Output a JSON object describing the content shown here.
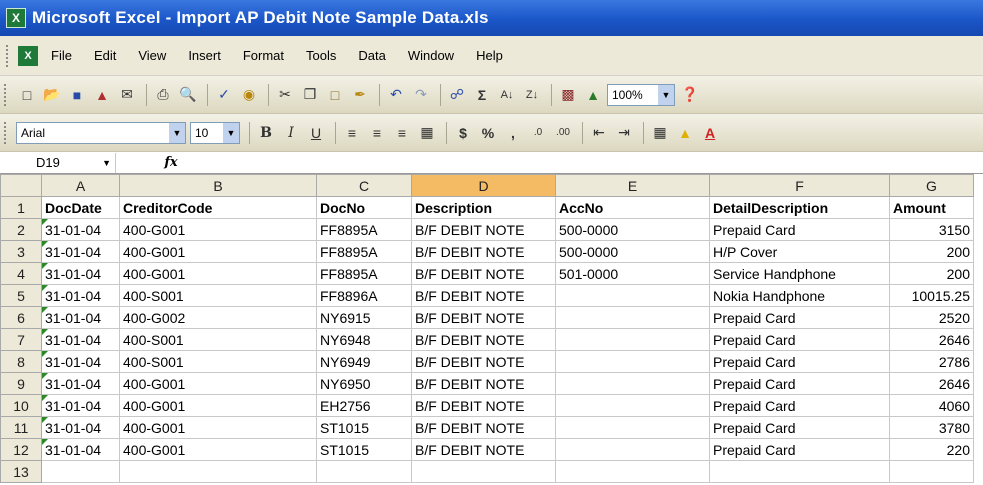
{
  "window": {
    "title": "Microsoft Excel - Import AP Debit Note Sample Data.xls",
    "app_icon": "excel-icon"
  },
  "menu": {
    "items": [
      "File",
      "Edit",
      "View",
      "Insert",
      "Format",
      "Tools",
      "Data",
      "Window",
      "Help"
    ]
  },
  "toolbar": {
    "zoom": "100%",
    "font_name": "Arial",
    "font_size": "10"
  },
  "formula_bar": {
    "cell_ref": "D19",
    "fx_label": "fx"
  },
  "sheet": {
    "columns": [
      "A",
      "B",
      "C",
      "D",
      "E",
      "F",
      "G"
    ],
    "selected_column": "D",
    "rows": [
      {
        "n": "1",
        "cells": [
          "DocDate",
          "CreditorCode",
          "DocNo",
          "Description",
          "AccNo",
          "DetailDescription",
          "Amount"
        ]
      },
      {
        "n": "2",
        "cells": [
          "31-01-04",
          "400-G001",
          "FF8895A",
          "B/F DEBIT NOTE",
          "500-0000",
          "Prepaid Card",
          "3150"
        ]
      },
      {
        "n": "3",
        "cells": [
          "31-01-04",
          "400-G001",
          "FF8895A",
          "B/F DEBIT NOTE",
          "500-0000",
          "H/P Cover",
          "200"
        ]
      },
      {
        "n": "4",
        "cells": [
          "31-01-04",
          "400-G001",
          "FF8895A",
          "B/F DEBIT NOTE",
          "501-0000",
          "Service Handphone",
          "200"
        ]
      },
      {
        "n": "5",
        "cells": [
          "31-01-04",
          "400-S001",
          "FF8896A",
          "B/F DEBIT NOTE",
          "",
          "Nokia Handphone",
          "10015.25"
        ]
      },
      {
        "n": "6",
        "cells": [
          "31-01-04",
          "400-G002",
          "NY6915",
          "B/F DEBIT NOTE",
          "",
          "Prepaid Card",
          "2520"
        ]
      },
      {
        "n": "7",
        "cells": [
          "31-01-04",
          "400-S001",
          "NY6948",
          "B/F DEBIT NOTE",
          "",
          "Prepaid Card",
          "2646"
        ]
      },
      {
        "n": "8",
        "cells": [
          "31-01-04",
          "400-S001",
          "NY6949",
          "B/F DEBIT NOTE",
          "",
          "Prepaid Card",
          "2786"
        ]
      },
      {
        "n": "9",
        "cells": [
          "31-01-04",
          "400-G001",
          "NY6950",
          "B/F DEBIT NOTE",
          "",
          "Prepaid Card",
          "2646"
        ]
      },
      {
        "n": "10",
        "cells": [
          "31-01-04",
          "400-G001",
          "EH2756",
          "B/F DEBIT NOTE",
          "",
          "Prepaid Card",
          "4060"
        ]
      },
      {
        "n": "11",
        "cells": [
          "31-01-04",
          "400-G001",
          "ST1015",
          "B/F DEBIT NOTE",
          "",
          "Prepaid Card",
          "3780"
        ]
      },
      {
        "n": "12",
        "cells": [
          "31-01-04",
          "400-G001",
          "ST1015",
          "B/F DEBIT NOTE",
          "",
          "Prepaid Card",
          "220"
        ]
      },
      {
        "n": "13",
        "cells": [
          "",
          "",
          "",
          "",
          "",
          "",
          ""
        ]
      }
    ]
  },
  "colors": {
    "title_bar": "#1b56c8",
    "toolbar_bg": "#ece9d8",
    "selected_column_header": "#f5bb64"
  }
}
